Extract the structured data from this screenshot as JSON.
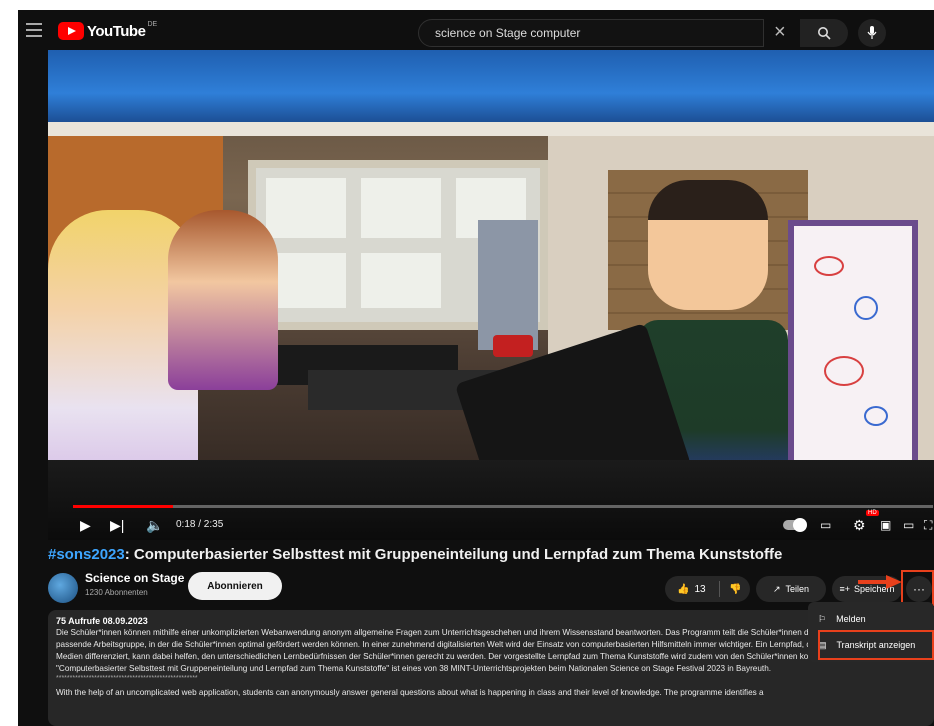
{
  "header": {
    "logo_text": "YouTube",
    "logo_country": "DE",
    "search_value": "science on Stage computer"
  },
  "player": {
    "time": "0:18 / 2:35",
    "progress_fraction": 0.116
  },
  "video": {
    "title_hashtag": "#sons2023",
    "title_rest": ": Computerbasierter Selbsttest mit Gruppeneinteilung und Lernpfad zum Thema Kunststoffe"
  },
  "channel": {
    "name": "Science on Stage",
    "subscribers": "1230 Abonnenten",
    "subscribe_label": "Abonnieren"
  },
  "actions": {
    "likes": "13",
    "share_label": "Teilen",
    "save_label": "Speichern",
    "more_label": "···"
  },
  "menu": {
    "report_label": "Melden",
    "transcript_label": "Transkript anzeigen"
  },
  "description": {
    "meta": "75 Aufrufe  08.09.2023",
    "text_de": "Die Schüler*innen können mithilfe einer unkomplizierten Webanwendung anonym allgemeine Fragen zum Unterrichtsgeschehen und ihrem Wissensstand beantworten. Das Programm teilt die Schüler*innen datenschutzkonform eine passende Arbeitsgruppe, in der die Schüler*innen optimal gefördert werden können. In einer zunehmend digitalisierten Welt wird der Einsatz von computerbasierten Hilfsmitteln immer wichtiger. Ein Lernpfad, der durch unterschiedliche Medien differenziert, kann dabei helfen, den unterschiedlichen Lernbedürfnissen der Schüler*innen gerecht zu werden. Der vorgestellte Lernpfad zum Thema Kunststoffe wird zudem von den Schüler*innen kollaborativ bearbeitet. \"Computerbasierter Selbsttest mit Gruppeneinteilung und Lernpfad zum Thema Kunststoffe\" ist eines von 38 MINT-Unterrichtsprojekten beim Nationalen Science on Stage Festival 2023 in Bayreuth.",
    "separator": "****************************************************",
    "text_en": "With the help of an uncomplicated web application, students can anonymously answer general questions about what is happening in class and their level of knowledge. The programme identifies a"
  },
  "colors": {
    "accent_red": "#ff0000",
    "highlight": "#e8401c",
    "link_blue": "#3ea6ff"
  }
}
